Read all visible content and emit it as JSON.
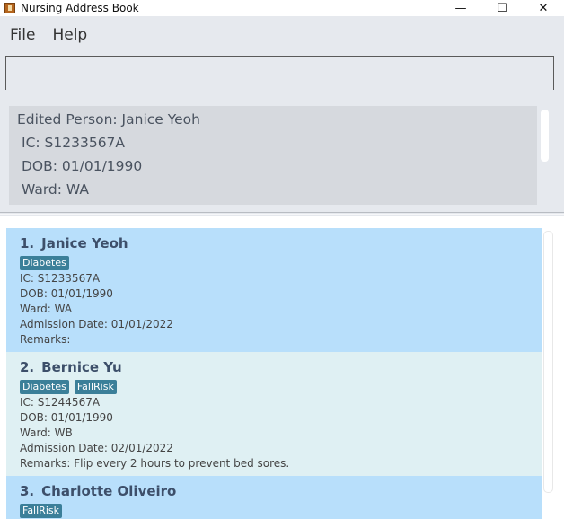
{
  "window": {
    "title": "Nursing Address Book",
    "minimize": "—",
    "maximize": "☐",
    "close": "✕"
  },
  "menu": {
    "file": "File",
    "help": "Help"
  },
  "command": {
    "value": "",
    "placeholder": ""
  },
  "result": {
    "lines": [
      "Edited Person: Janice Yeoh",
      "IC: S1233567A",
      "DOB: 01/01/1990",
      "Ward: WA"
    ]
  },
  "persons": [
    {
      "index": "1.",
      "name": "Janice Yeoh",
      "tags": [
        "Diabetes"
      ],
      "ic": "IC: S1233567A",
      "dob": "DOB: 01/01/1990",
      "ward": "Ward: WA",
      "admission": "Admission Date: 01/01/2022",
      "remarks": "Remarks:"
    },
    {
      "index": "2.",
      "name": "Bernice Yu",
      "tags": [
        "Diabetes",
        "FallRisk"
      ],
      "ic": "IC: S1244567A",
      "dob": "DOB: 01/01/1990",
      "ward": "Ward: WB",
      "admission": "Admission Date: 02/01/2022",
      "remarks": "Remarks: Flip every 2 hours to prevent bed sores."
    },
    {
      "index": "3.",
      "name": "Charlotte Oliveiro",
      "tags": [
        "FallRisk"
      ]
    }
  ],
  "colors": {
    "selected_card": "#b8dffb",
    "alt_card": "#dff0f3",
    "tag": "#3b7f99"
  }
}
